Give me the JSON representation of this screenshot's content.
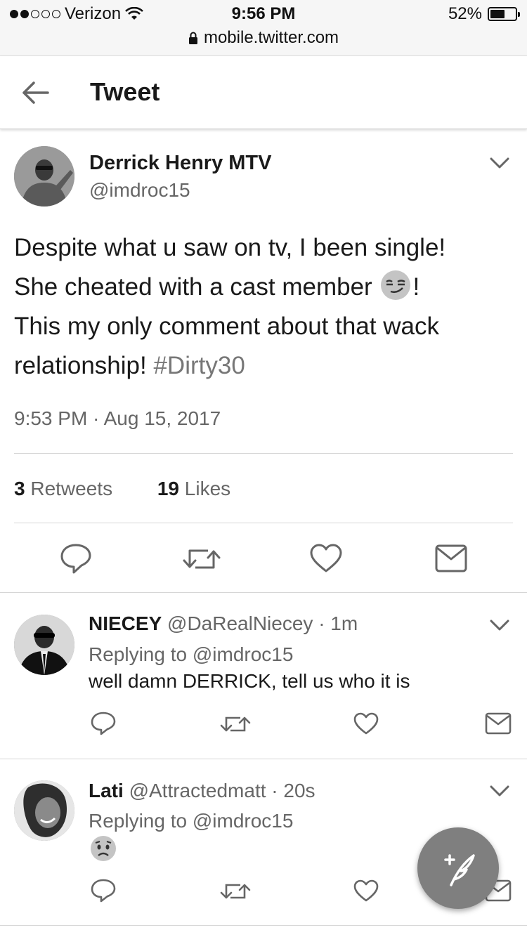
{
  "status_bar": {
    "carrier": "Verizon",
    "time": "9:56 PM",
    "battery": "52%",
    "battery_level": 0.52,
    "url": "mobile.twitter.com"
  },
  "header": {
    "title": "Tweet",
    "back_icon": "arrow-left-icon"
  },
  "main_tweet": {
    "name": "Derrick Henry MTV",
    "handle": "@imdroc15",
    "line1": "Despite what u saw on tv, I been single!",
    "line2a": "She cheated with a cast member",
    "line2b": "!",
    "line3": "This my only comment about that wack",
    "line4a": "relationship!",
    "hashtag": "#Dirty30",
    "timestamp": "9:53 PM · Aug 15, 2017",
    "retweets_count": "3",
    "retweets_label": "Retweets",
    "likes_count": "19",
    "likes_label": "Likes"
  },
  "replies": [
    {
      "name": "NIECEY",
      "handle_time": "@DaRealNiecey · 1m",
      "replying": "Replying to @imdroc15",
      "text": "well damn DERRICK, tell us who it is"
    },
    {
      "name": "Lati",
      "handle_time": "@Attractedmatt · 20s",
      "replying": "Replying to @imdroc15",
      "text": ""
    }
  ],
  "icons": [
    "reply-icon",
    "retweet-icon",
    "like-icon",
    "message-icon",
    "chevron-down-icon",
    "compose-tweet-icon"
  ]
}
